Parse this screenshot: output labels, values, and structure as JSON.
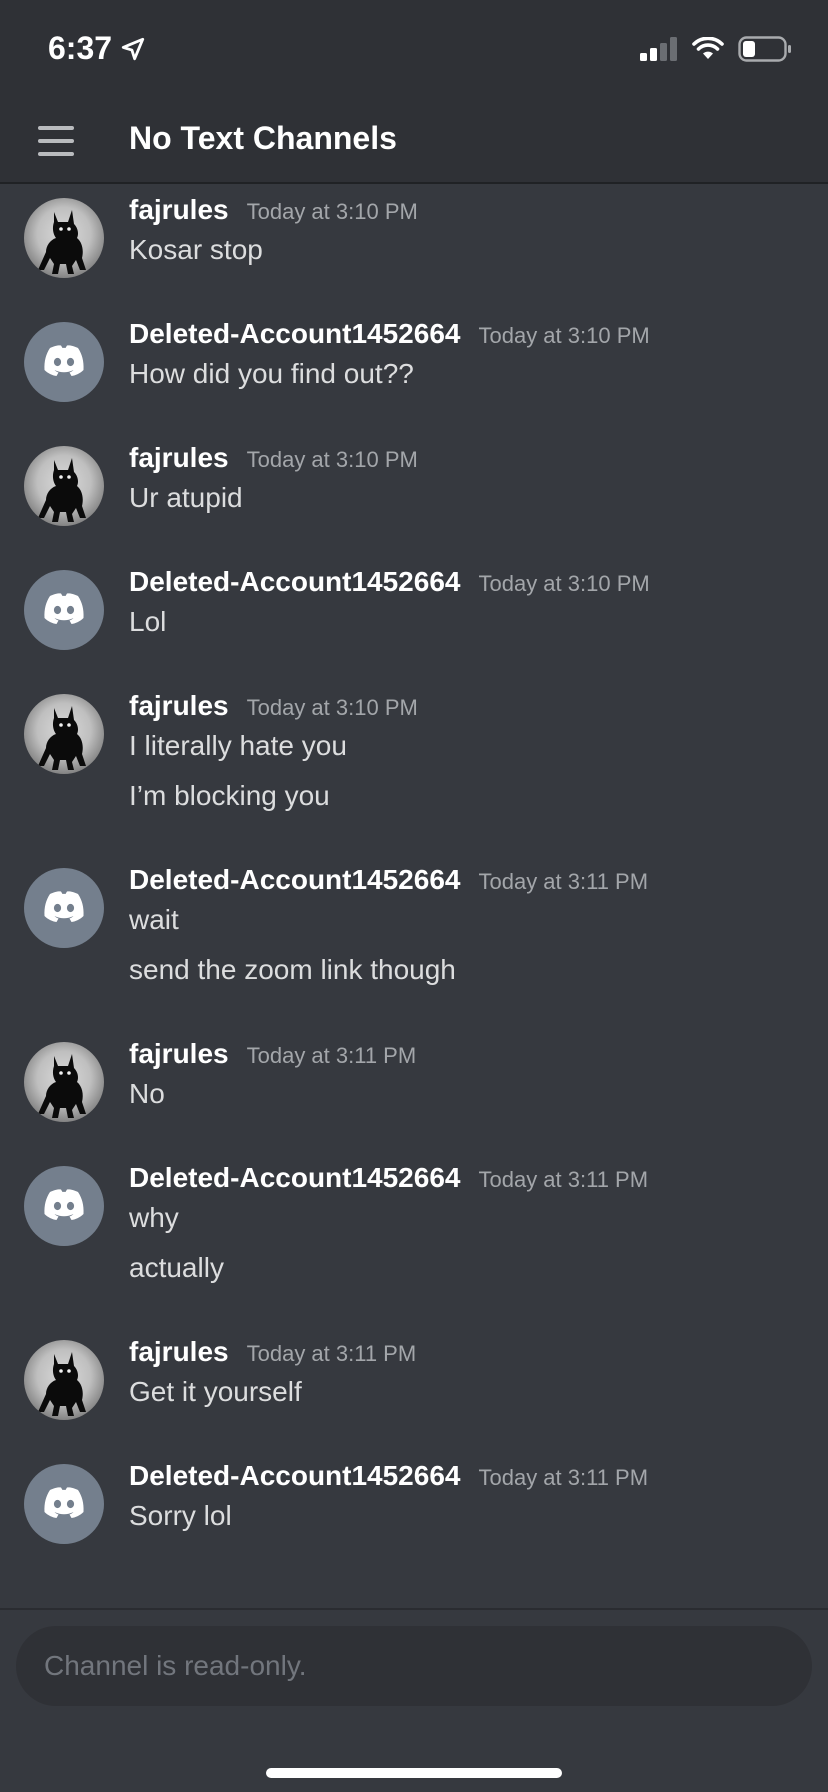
{
  "status": {
    "time": "6:37"
  },
  "header": {
    "title": "No Text Channels"
  },
  "messages": [
    {
      "user": "fajrules",
      "time": "Today at 3:10 PM",
      "avatar": "cat",
      "lines": [
        "Kosar stop"
      ]
    },
    {
      "user": "Deleted-Account1452664",
      "time": "Today at 3:10 PM",
      "avatar": "discord",
      "lines": [
        "How did you find out??"
      ]
    },
    {
      "user": "fajrules",
      "time": "Today at 3:10 PM",
      "avatar": "cat",
      "lines": [
        "Ur atupid"
      ]
    },
    {
      "user": "Deleted-Account1452664",
      "time": "Today at 3:10 PM",
      "avatar": "discord",
      "lines": [
        "Lol"
      ]
    },
    {
      "user": "fajrules",
      "time": "Today at 3:10 PM",
      "avatar": "cat",
      "lines": [
        "I literally hate you",
        "I’m blocking you"
      ]
    },
    {
      "user": "Deleted-Account1452664",
      "time": "Today at 3:11 PM",
      "avatar": "discord",
      "lines": [
        "wait",
        "send the zoom link though"
      ]
    },
    {
      "user": "fajrules",
      "time": "Today at 3:11 PM",
      "avatar": "cat",
      "lines": [
        "No"
      ]
    },
    {
      "user": "Deleted-Account1452664",
      "time": "Today at 3:11 PM",
      "avatar": "discord",
      "lines": [
        "why",
        "actually"
      ]
    },
    {
      "user": "fajrules",
      "time": "Today at 3:11 PM",
      "avatar": "cat",
      "lines": [
        "Get it yourself"
      ]
    },
    {
      "user": "Deleted-Account1452664",
      "time": "Today at 3:11 PM",
      "avatar": "discord",
      "lines": [
        "Sorry lol"
      ]
    }
  ],
  "composer": {
    "placeholder": "Channel is read-only."
  }
}
